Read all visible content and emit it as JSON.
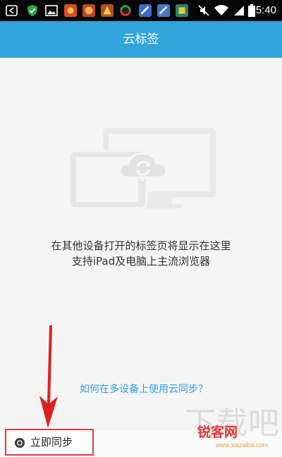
{
  "status_bar": {
    "time": "5:40",
    "icons": [
      "back-icon",
      "shield-icon",
      "image-icon",
      "app-icon",
      "app-icon",
      "app-icon",
      "app-icon",
      "app-icon",
      "app-icon",
      "mute-icon",
      "wifi-icon",
      "signal-icon",
      "battery-icon"
    ]
  },
  "header": {
    "title": "云标签"
  },
  "empty_state": {
    "line1": "在其他设备打开的标签页将显示在这里",
    "line2": "支持iPad及电脑上主流浏览器"
  },
  "help_link": "如何在多设备上使用云同步？",
  "sync_button": {
    "label": "立即同步"
  },
  "watermark": {
    "big": "下载吧",
    "logo": "锐客网",
    "url": "www.xiazaiba.com"
  },
  "colors": {
    "title_bar": "#33a3dc",
    "link": "#2e9ee0",
    "highlight": "#e23b3b"
  }
}
